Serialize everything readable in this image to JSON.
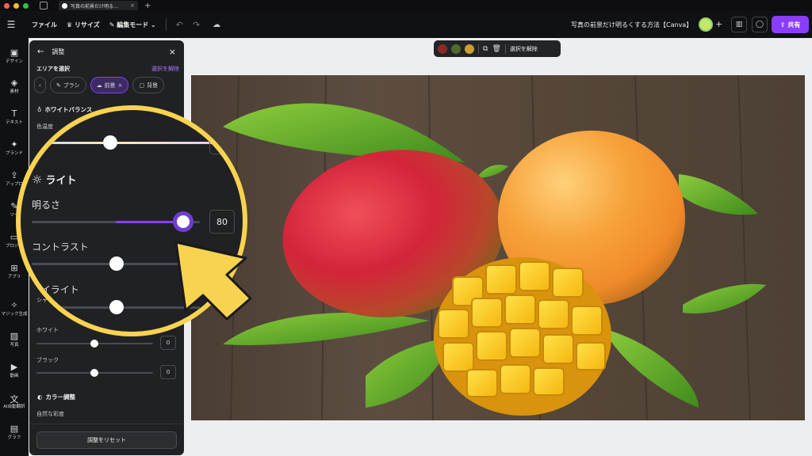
{
  "browser": {
    "tab_title": "写真の前景だけ明る…"
  },
  "topbar": {
    "file": "ファイル",
    "resize": "リサイズ",
    "edit_mode": "編集モード",
    "doc_title": "写真の前景だけ明るくする方法【Canva】",
    "share": "共有"
  },
  "sidebar": {
    "items": [
      {
        "label": "デザイン",
        "icon": "layout-icon"
      },
      {
        "label": "素材",
        "icon": "shapes-icon"
      },
      {
        "label": "テキスト",
        "icon": "text-icon"
      },
      {
        "label": "ブランド",
        "icon": "brand-icon"
      },
      {
        "label": "アップロ",
        "icon": "upload-icon"
      },
      {
        "label": "ツー",
        "icon": "tools-icon"
      },
      {
        "label": "プロジェ",
        "icon": "folder-icon"
      },
      {
        "label": "アプリ",
        "icon": "apps-icon"
      },
      {
        "label": "マジック生成",
        "icon": "magic-icon"
      },
      {
        "label": "写真",
        "icon": "photo-icon"
      },
      {
        "label": "動画",
        "icon": "video-icon"
      },
      {
        "label": "AI自動翻訳",
        "icon": "translate-icon"
      },
      {
        "label": "グラフ",
        "icon": "chart-icon"
      }
    ]
  },
  "float_toolbar": {
    "colors": [
      "#8a2a25",
      "#4f6b2e",
      "#c9a030"
    ],
    "deselect": "選択を解除"
  },
  "panel": {
    "title": "調整",
    "area_label": "エリアを選択",
    "deselect_link": "選択を解除",
    "chips": [
      "ブラシ",
      "前景",
      "背景"
    ],
    "white_balance": "ホワイトバランス",
    "color_temp": "色温度",
    "shadow": "シャ",
    "white": "ホワイト",
    "white_value": "0",
    "black": "ブラック",
    "black_value": "0",
    "color_adjust": "カラー調整",
    "natural_saturation": "自然な彩度",
    "reset": "調整をリセット"
  },
  "zoom": {
    "light": "ライト",
    "brightness": "明るさ",
    "brightness_value": "80",
    "brightness_fraction": 0.9,
    "contrast": "コントラスト",
    "highlight": "ハイライト"
  },
  "colors": {
    "accent": "#8b3dff",
    "highlight_ring": "#f8d34f"
  }
}
